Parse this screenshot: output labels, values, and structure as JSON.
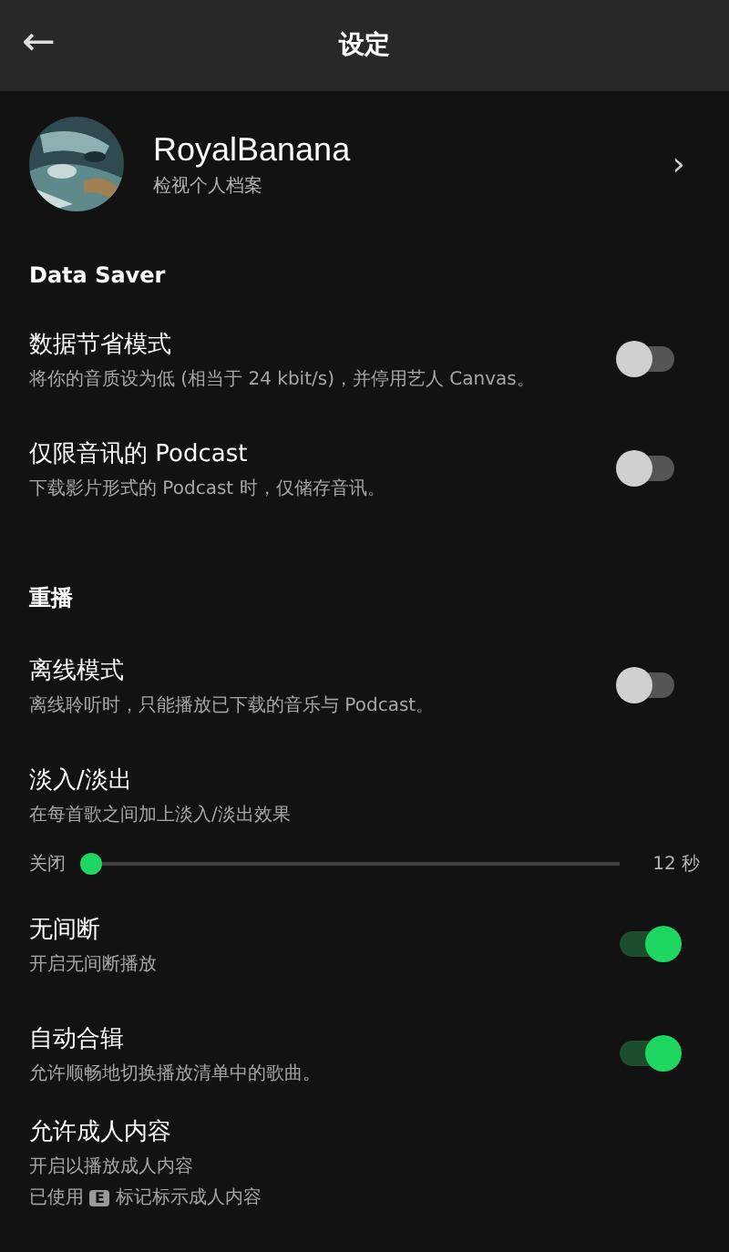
{
  "header": {
    "back_icon": "←",
    "title": "设定"
  },
  "profile": {
    "name": "RoyalBanana",
    "subtitle": "检视个人档案",
    "chevron": "›"
  },
  "sections": [
    {
      "title": "Data Saver",
      "items": [
        {
          "kind": "toggle",
          "title": "数据节省模式",
          "subtitle": "将你的音质设为低 (相当于 24 kbit/s)，并停用艺人 Canvas。",
          "on": false
        },
        {
          "kind": "toggle",
          "title": "仅限音讯的 Podcast",
          "subtitle": "下载影片形式的 Podcast 时，仅储存音讯。",
          "on": false
        }
      ]
    },
    {
      "title": "重播",
      "items": [
        {
          "kind": "toggle",
          "title": "离线模式",
          "subtitle": "离线聆听时，只能播放已下载的音乐与 Podcast。",
          "on": false
        },
        {
          "kind": "slider",
          "title": "淡入/淡出",
          "subtitle": "在每首歌之间加上淡入/淡出效果",
          "min_label": "关闭",
          "max_label": "12 秒",
          "level": 0
        },
        {
          "kind": "toggle",
          "title": "无间断",
          "subtitle": "开启无间断播放",
          "on": true
        },
        {
          "kind": "toggle",
          "title": "自动合辑",
          "subtitle": "允许顺畅地切换播放清单中的歌曲。",
          "on": true
        },
        {
          "kind": "plain",
          "title": "允许成人内容",
          "subtitle": "开启以播放成人内容",
          "note": {
            "before": "已使用",
            "badge": "E",
            "after": "标记标示成人内容"
          }
        }
      ]
    }
  ]
}
